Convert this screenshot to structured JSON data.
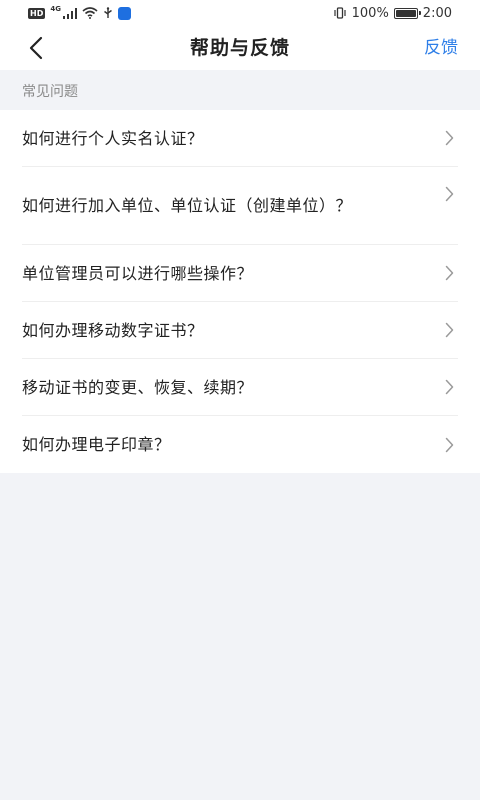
{
  "status_bar": {
    "hd": "HD",
    "network": "4G",
    "battery_percent": "100%",
    "battery_level": 1.0,
    "time": "2:00"
  },
  "nav": {
    "title": "帮助与反馈",
    "feedback_label": "反馈",
    "back_icon": "chevron-left-icon"
  },
  "section": {
    "title": "常见问题"
  },
  "faq_items": [
    "如何进行个人实名认证？",
    "如何进行加入单位、单位认证（创建单位）？",
    "单位管理员可以进行哪些操作？",
    "如何办理移动数字证书？",
    "移动证书的变更、恢复、续期？",
    "如何办理电子印章？"
  ],
  "colors": {
    "accent": "#2f7fe8",
    "background": "#f2f3f7",
    "text": "#222222",
    "muted": "#8a8a8a"
  }
}
